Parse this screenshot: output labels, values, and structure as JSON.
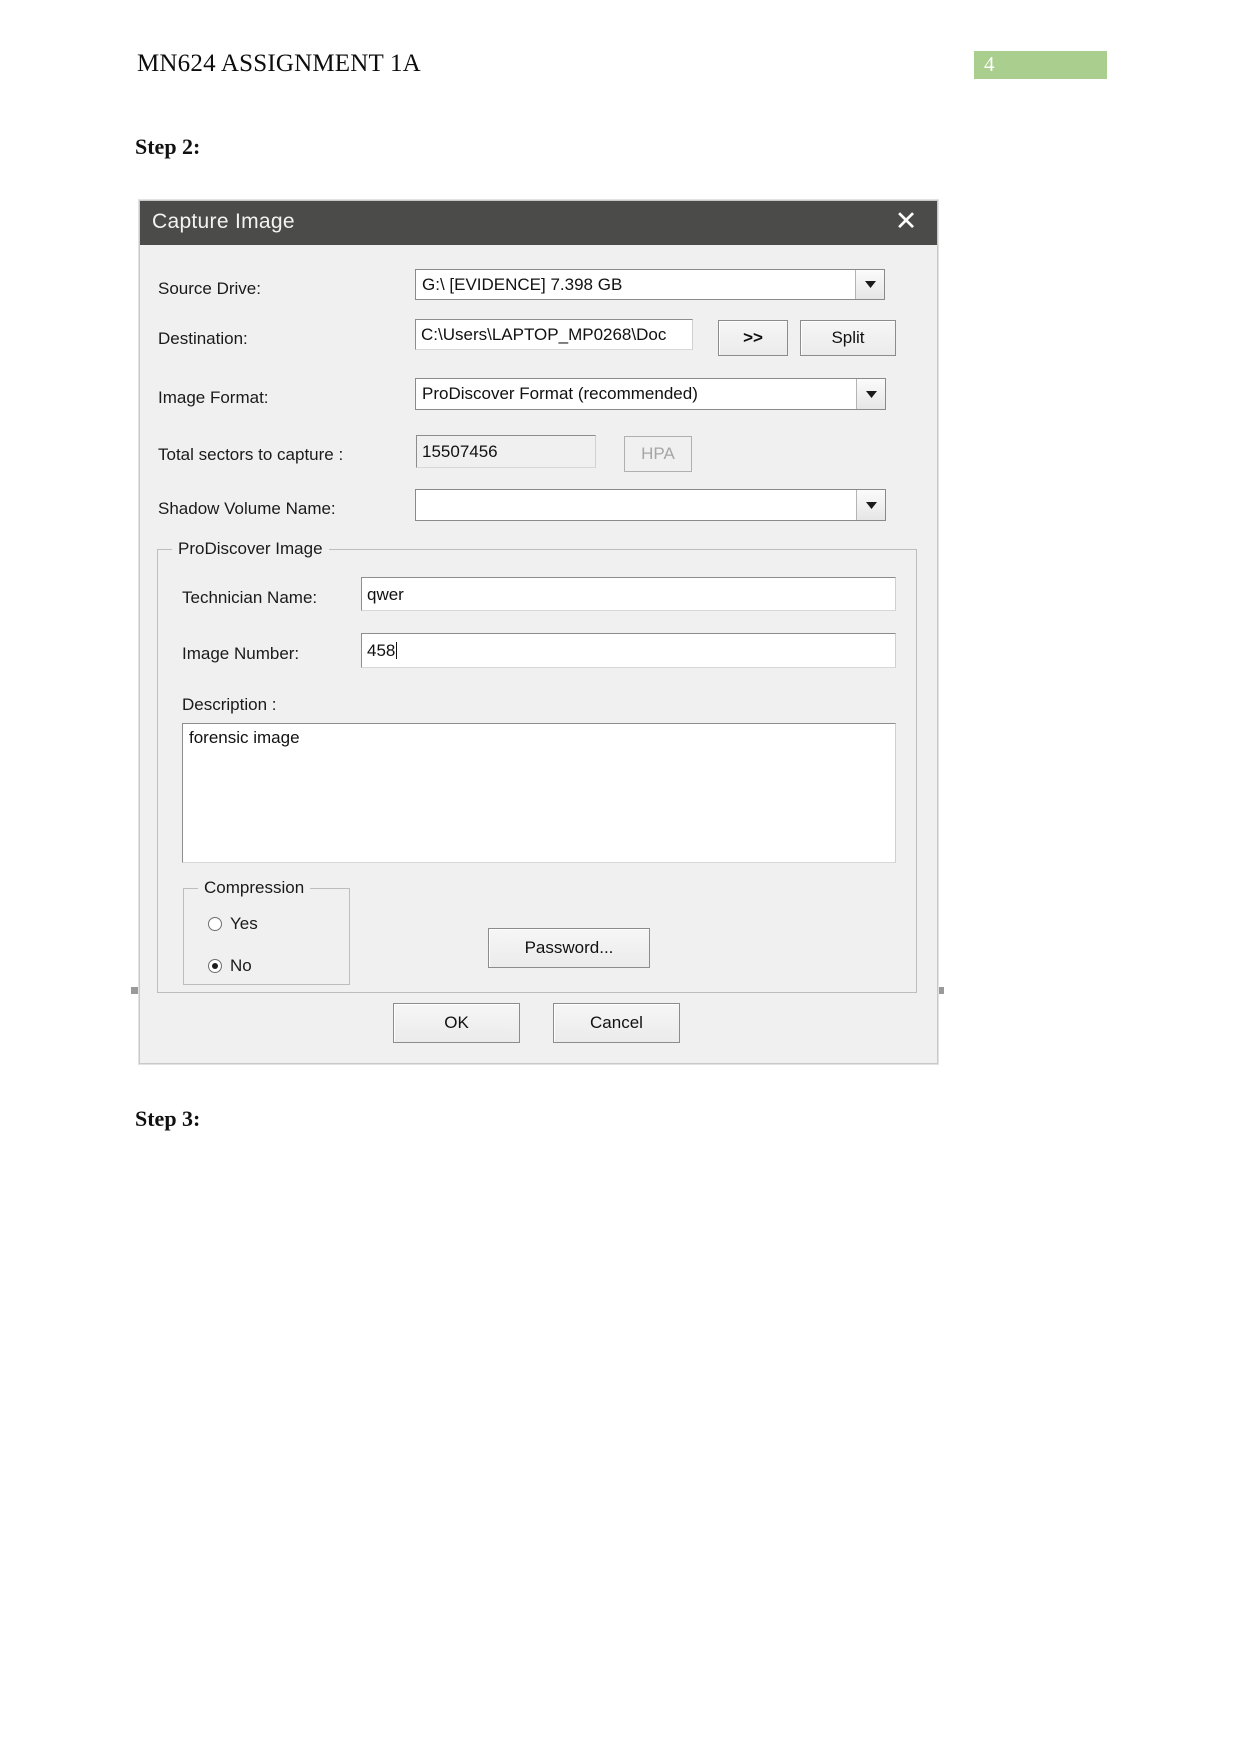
{
  "document": {
    "header_title": "MN624 ASSIGNMENT 1A",
    "page_number": "4",
    "page_badge_color": "#a9ce8d",
    "step2_label": "Step 2:",
    "step3_label": "Step 3:"
  },
  "dialog": {
    "title": "Capture Image",
    "close_icon": "close-icon",
    "titlebar_color": "#4b4b49",
    "fields": {
      "source_drive": {
        "label": "Source Drive:",
        "value": "G:\\ [EVIDENCE] 7.398 GB",
        "control": "combobox"
      },
      "destination": {
        "label": "Destination:",
        "value": "C:\\Users\\LAPTOP_MP0268\\Doc",
        "control": "textbox"
      },
      "image_format": {
        "label": "Image Format:",
        "value": "ProDiscover Format (recommended)",
        "control": "combobox"
      },
      "total_sectors": {
        "label": "Total sectors to capture :",
        "value": "15507456",
        "control": "textbox"
      },
      "shadow_volume": {
        "label": "Shadow Volume Name:",
        "value": "",
        "control": "combobox"
      }
    },
    "buttons": {
      "browse": ">>",
      "split": "Split",
      "hpa": "HPA",
      "password": "Password...",
      "ok": "OK",
      "cancel": "Cancel"
    },
    "prodiscover_group": {
      "title": "ProDiscover Image",
      "technician_name": {
        "label": "Technician Name:",
        "value": "qwer"
      },
      "image_number": {
        "label": "Image Number:",
        "value": "458"
      },
      "description": {
        "label": "Description :",
        "value": "forensic image"
      }
    },
    "compression_group": {
      "title": "Compression",
      "options": [
        {
          "label": "Yes",
          "selected": false
        },
        {
          "label": "No",
          "selected": true
        }
      ]
    }
  }
}
